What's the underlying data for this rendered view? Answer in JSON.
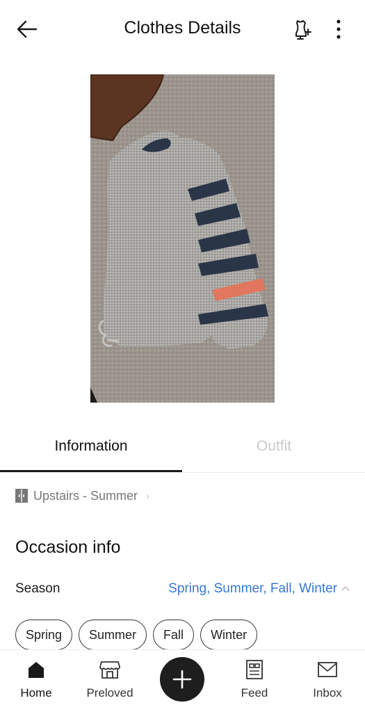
{
  "header": {
    "title": "Clothes Details",
    "back_icon": "arrow-left-icon",
    "outfit_icon": "dress-form-add-icon",
    "more_icon": "more-vertical-icon"
  },
  "photo": {
    "subject": "grey knit sweater with navy and coral striped sleeve on carpet"
  },
  "tabs": [
    {
      "label": "Information",
      "active": true
    },
    {
      "label": "Outfit",
      "active": false
    }
  ],
  "location": {
    "icon": "closet-icon",
    "label": "Upstairs - Summer"
  },
  "occasion": {
    "title": "Occasion info",
    "season_label": "Season",
    "season_value": "Spring, Summer, Fall, Winter",
    "chips": [
      "Spring",
      "Summer",
      "Fall",
      "Winter"
    ]
  },
  "nav": {
    "home": "Home",
    "preloved": "Preloved",
    "feed": "Feed",
    "inbox": "Inbox"
  },
  "colors": {
    "accent_blue": "#3577d4",
    "text_dark": "#111111",
    "inactive_tab": "#c9c9c9",
    "fab": "#1e1e1e"
  }
}
